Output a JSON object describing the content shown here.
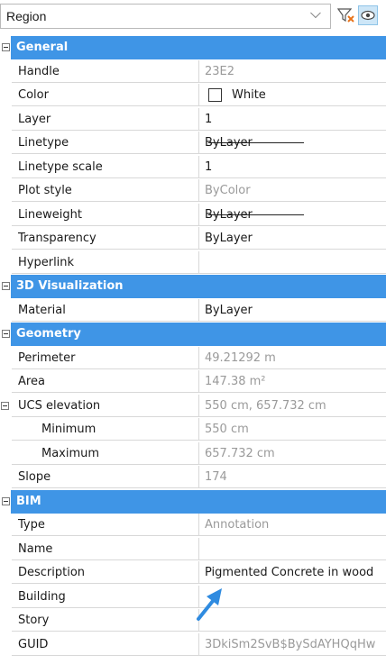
{
  "selector": {
    "value": "Region"
  },
  "colors": {
    "section": "#3f95e6",
    "arrow": "#2f8be0"
  },
  "sections": [
    {
      "title": "General",
      "rows": [
        {
          "name": "Handle",
          "value": "23E2",
          "readonly": true
        },
        {
          "name": "Color",
          "value": "White",
          "swatch": true
        },
        {
          "name": "Layer",
          "value": "1"
        },
        {
          "name": "Linetype",
          "value": "ByLayer",
          "line": true
        },
        {
          "name": "Linetype scale",
          "value": "1"
        },
        {
          "name": "Plot style",
          "value": "ByColor",
          "readonly": true
        },
        {
          "name": "Lineweight",
          "value": "ByLayer",
          "line": true
        },
        {
          "name": "Transparency",
          "value": "ByLayer"
        },
        {
          "name": "Hyperlink",
          "value": ""
        }
      ]
    },
    {
      "title": "3D Visualization",
      "rows": [
        {
          "name": "Material",
          "value": "ByLayer"
        }
      ]
    },
    {
      "title": "Geometry",
      "rows": [
        {
          "name": "Perimeter",
          "value": "49.21292 m",
          "readonly": true
        },
        {
          "name": "Area",
          "value": "147.38 m²",
          "readonly": true
        },
        {
          "name": "UCS elevation",
          "value": "550 cm, 657.732 cm",
          "readonly": true,
          "expandable": true
        },
        {
          "name": "Minimum",
          "value": "550 cm",
          "readonly": true,
          "indent": true
        },
        {
          "name": "Maximum",
          "value": "657.732 cm",
          "readonly": true,
          "indent": true
        },
        {
          "name": "Slope",
          "value": "174",
          "readonly": true
        }
      ]
    },
    {
      "title": "BIM",
      "rows": [
        {
          "name": "Type",
          "value": "Annotation",
          "readonly": true
        },
        {
          "name": "Name",
          "value": ""
        },
        {
          "name": "Description",
          "value": "Pigmented Concrete in wood"
        },
        {
          "name": "Building",
          "value": ""
        },
        {
          "name": "Story",
          "value": ""
        },
        {
          "name": "GUID",
          "value": "3DkiSm2SvB$BySdAYHQqHw",
          "readonly": true
        }
      ]
    }
  ]
}
